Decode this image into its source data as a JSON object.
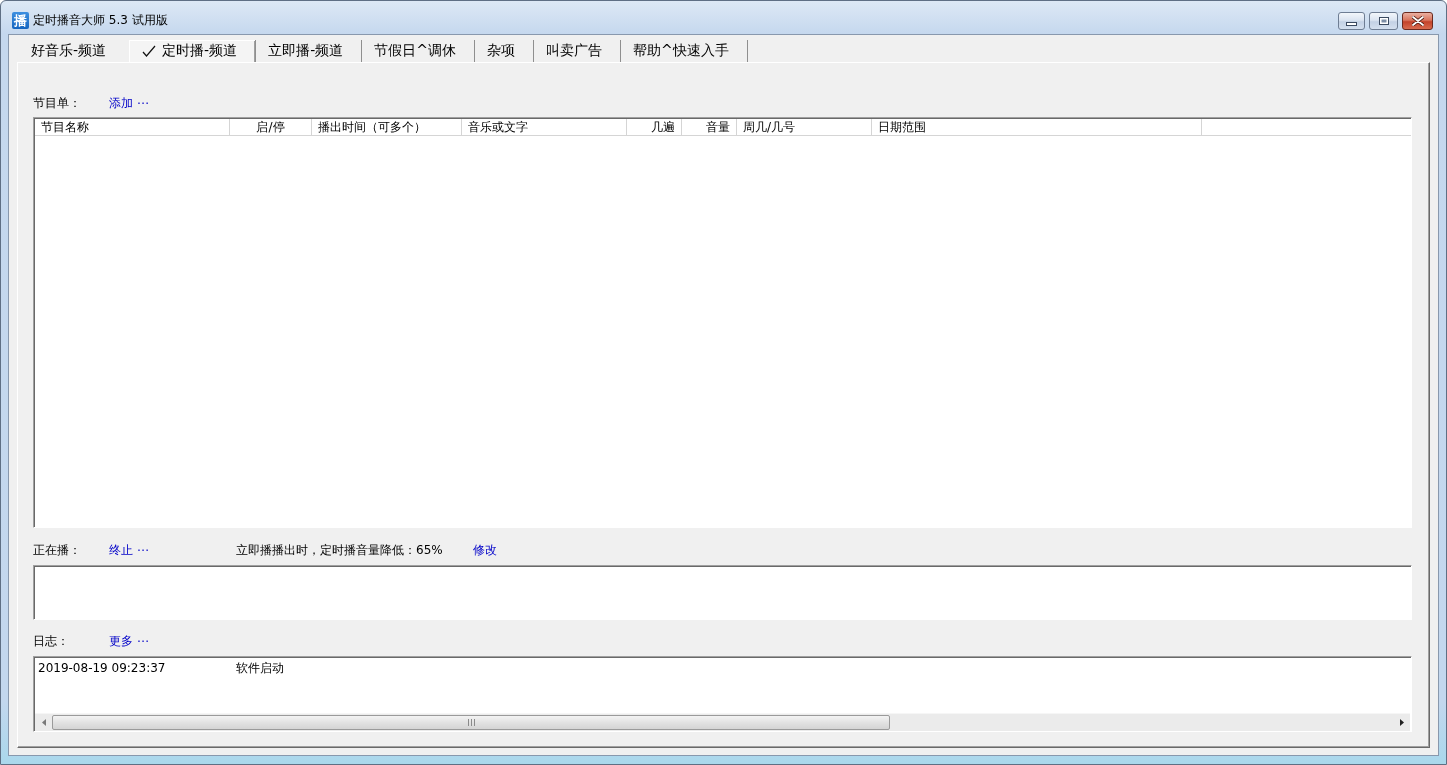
{
  "window": {
    "title": "定时播音大师 5.3 试用版",
    "icon_text": "播"
  },
  "tabs": [
    {
      "label": "好音乐-频道",
      "selected": false
    },
    {
      "label": "定时播-频道",
      "selected": true
    },
    {
      "label": "立即播-频道",
      "selected": false
    },
    {
      "label": "节假日^调休",
      "selected": false
    },
    {
      "label": "杂项",
      "selected": false
    },
    {
      "label": "叫卖广告",
      "selected": false
    },
    {
      "label": "帮助^快速入手",
      "selected": false
    }
  ],
  "program_list": {
    "label": "节目单：",
    "action": "添加 ⋯",
    "columns": [
      {
        "label": "节目名称",
        "kind": "text"
      },
      {
        "label": "启/停",
        "kind": "toggle"
      },
      {
        "label": "播出时间（可多个）",
        "kind": "text"
      },
      {
        "label": "音乐或文字",
        "kind": "text"
      },
      {
        "label": "几遍",
        "kind": "number"
      },
      {
        "label": "音量",
        "kind": "number"
      },
      {
        "label": "周几/几号",
        "kind": "text"
      },
      {
        "label": "日期范围",
        "kind": "text"
      }
    ]
  },
  "now_playing": {
    "label": "正在播：",
    "action": "终止 ⋯",
    "note": "立即播播出时，定时播音量降低：65%",
    "note_action": "修改"
  },
  "log": {
    "label": "日志：",
    "action": "更多 ⋯",
    "entries": [
      {
        "time": "2019-08-19 09:23:37",
        "message": "软件启动"
      }
    ]
  }
}
